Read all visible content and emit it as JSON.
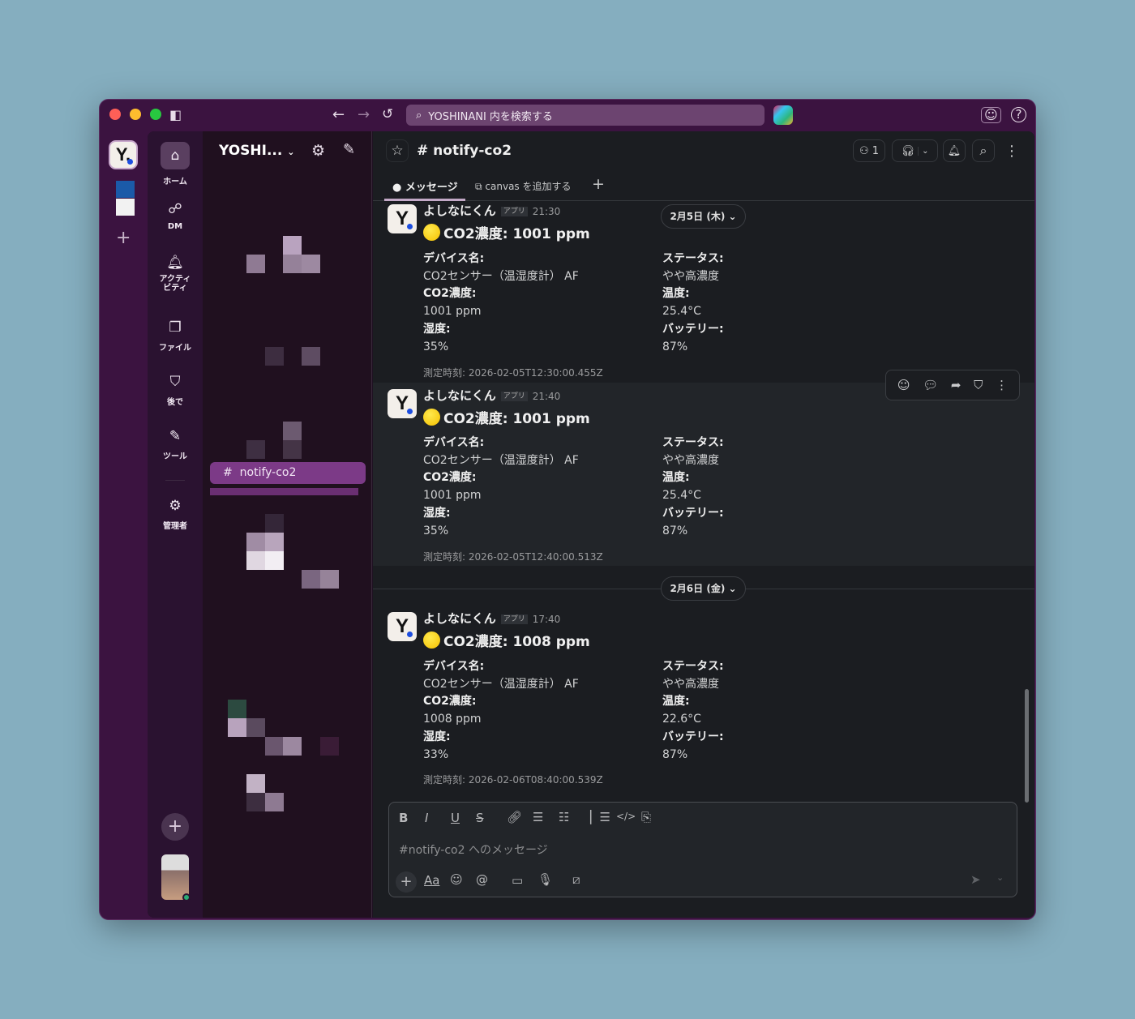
{
  "titlebar": {
    "search_placeholder": "YOSHINANI 内を検索する"
  },
  "workspace": {
    "initial": "Y.",
    "name": "YOSHI..."
  },
  "nav": [
    {
      "label": "ホーム",
      "icon": "home-icon"
    },
    {
      "label": "DM",
      "icon": "dm-icon"
    },
    {
      "label": "アクティ\nビティ",
      "icon": "bell-icon"
    },
    {
      "label": "ファイル",
      "icon": "files-icon"
    },
    {
      "label": "後で",
      "icon": "bookmark-icon"
    },
    {
      "label": "ツール",
      "icon": "tools-icon"
    },
    {
      "label": "管理者",
      "icon": "gear-icon"
    }
  ],
  "sidebar": {
    "active_channel": "notify-co2"
  },
  "channel": {
    "name": "# notify-co2",
    "member_count": "1",
    "tabs": [
      {
        "label": "メッセージ"
      },
      {
        "label": "canvas を追加する"
      }
    ]
  },
  "labels": {
    "device": "デバイス名:",
    "co2": "CO2濃度:",
    "humidity": "湿度:",
    "status": "ステータス:",
    "temp": "温度:",
    "battery": "バッテリー:",
    "app_badge": "アプリ"
  },
  "messages": [
    {
      "sender": "よしなにくん",
      "time": "21:30",
      "title": "CO2濃度: 1001 ppm",
      "device": "CO2センサー（温湿度計） AF",
      "co2": "1001 ppm",
      "humidity": "35%",
      "status": "やや高濃度",
      "temp": "25.4°C",
      "battery": "87%",
      "measured": "測定時刻: 2026-02-05T12:30:00.455Z"
    },
    {
      "sender": "よしなにくん",
      "time": "21:40",
      "title": "CO2濃度: 1001 ppm",
      "device": "CO2センサー（温湿度計） AF",
      "co2": "1001 ppm",
      "humidity": "35%",
      "status": "やや高濃度",
      "temp": "25.4°C",
      "battery": "87%",
      "measured": "測定時刻: 2026-02-05T12:40:00.513Z"
    },
    {
      "sender": "よしなにくん",
      "time": "17:40",
      "title": "CO2濃度: 1008 ppm",
      "device": "CO2センサー（温湿度計） AF",
      "co2": "1008 ppm",
      "humidity": "33%",
      "status": "やや高濃度",
      "temp": "22.6°C",
      "battery": "87%",
      "measured": "測定時刻: 2026-02-06T08:40:00.539Z"
    }
  ],
  "dates": [
    "2月5日 (木) ⌄",
    "2月6日 (金) ⌄"
  ],
  "composer": {
    "placeholder": "#notify-co2 へのメッセージ",
    "format_label": "Aa"
  }
}
